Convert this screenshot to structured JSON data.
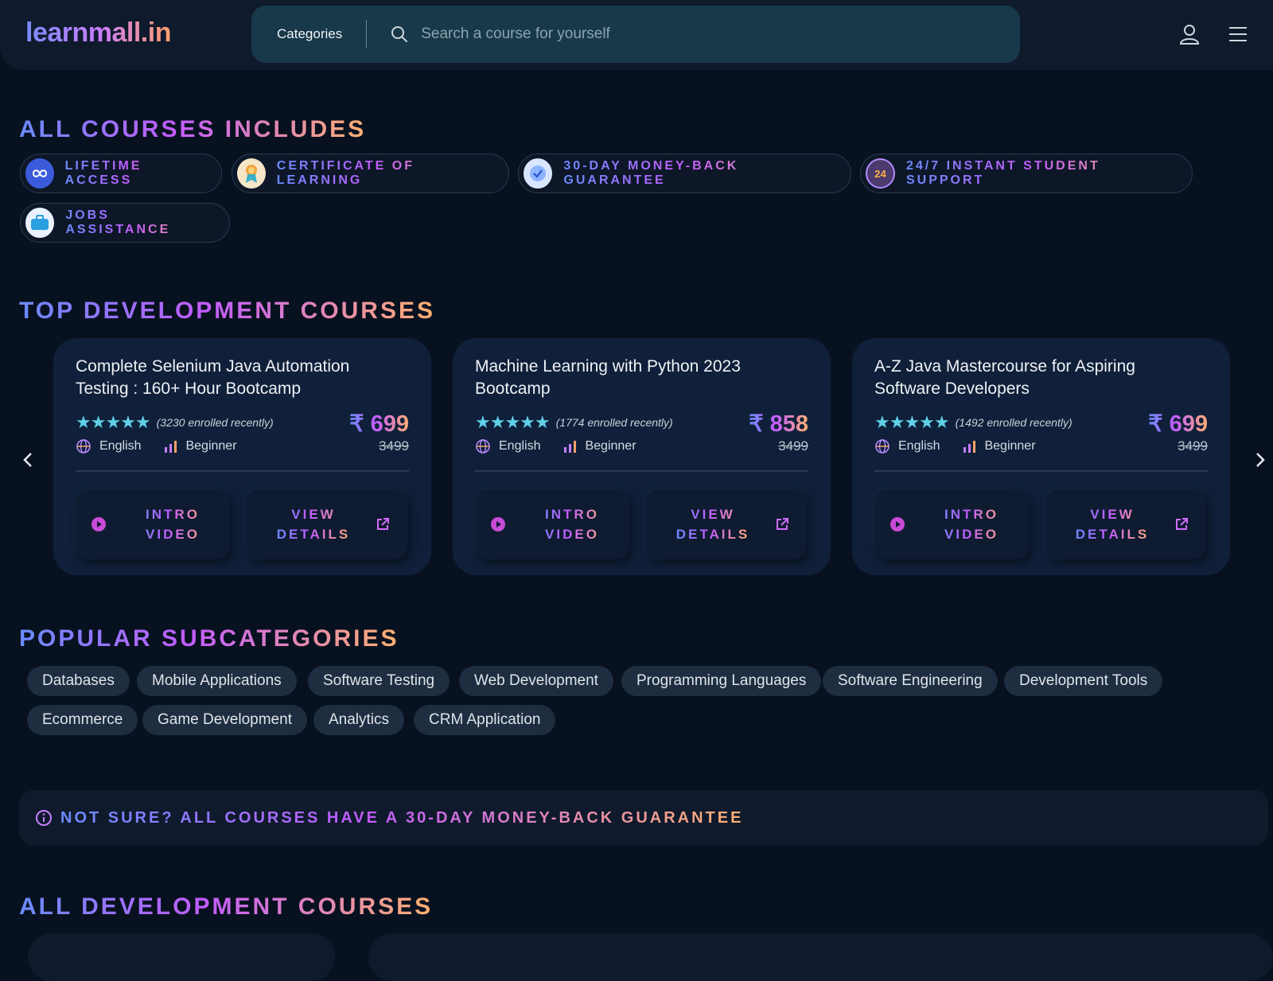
{
  "header": {
    "logo": "learnmall.in",
    "categories_label": "Categories",
    "search_placeholder": "Search a course for yourself"
  },
  "includes": {
    "title": "ALL COURSES INCLUDES",
    "items": [
      {
        "label": "LIFETIME ACCESS",
        "icon": "infinity-icon"
      },
      {
        "label": "CERTIFICATE OF LEARNING",
        "icon": "certificate-icon"
      },
      {
        "label": "30-DAY MONEY-BACK GUARANTEE",
        "icon": "check-badge-icon"
      },
      {
        "label": "24/7 INSTANT STUDENT SUPPORT",
        "icon": "support-24-icon",
        "icon_text": "24"
      },
      {
        "label": "JOBS ASSISTANCE",
        "icon": "briefcase-icon"
      }
    ]
  },
  "top_courses": {
    "title": "TOP DEVELOPMENT COURSES",
    "courses": [
      {
        "title": "Complete Selenium Java Automation Testing : 160+ Hour Bootcamp",
        "stars": "★★★★★",
        "rating": 4.5,
        "enrolled": "(3230 enrolled recently)",
        "language": "English",
        "level": "Beginner",
        "price": "₹ 699",
        "old_price": "3499",
        "intro_label": "INTRO VIDEO",
        "details_label": "VIEW DETAILS"
      },
      {
        "title": "Machine Learning with Python 2023 Bootcamp",
        "stars": "★★★★★",
        "rating": 5,
        "enrolled": "(1774 enrolled recently)",
        "language": "English",
        "level": "Beginner",
        "price": "₹ 858",
        "old_price": "3499",
        "intro_label": "INTRO VIDEO",
        "details_label": "VIEW DETAILS"
      },
      {
        "title": "A-Z Java Mastercourse for Aspiring Software Developers",
        "stars": "★★★★★",
        "rating": 5,
        "enrolled": "(1492 enrolled recently)",
        "language": "English",
        "level": "Beginner",
        "price": "₹ 699",
        "old_price": "3499",
        "intro_label": "INTRO VIDEO",
        "details_label": "VIEW DETAILS"
      }
    ]
  },
  "subcategories": {
    "title": "POPULAR SUBCATEGORIES",
    "items": [
      "Databases",
      "Mobile Applications",
      "Software Testing",
      "Web Development",
      "Programming Languages",
      "Software Engineering",
      "Development Tools",
      "Ecommerce",
      "Game Development",
      "Analytics",
      "CRM Application"
    ]
  },
  "guarantee": {
    "text": "NOT SURE? ALL COURSES HAVE A 30-DAY MONEY-BACK GUARANTEE"
  },
  "all_courses": {
    "title": "ALL DEVELOPMENT COURSES"
  },
  "colors": {
    "background": "#08111f",
    "accent_start": "#6a8cff",
    "accent_mid": "#c25cff",
    "accent_end": "#ffb070",
    "star": "#5fd0e8"
  }
}
